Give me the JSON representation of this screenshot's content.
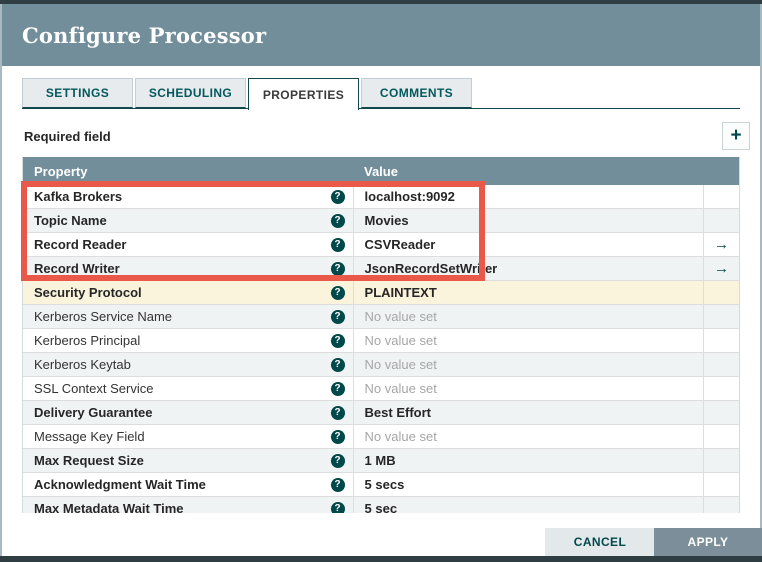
{
  "dialog": {
    "title": "Configure Processor"
  },
  "tabs": [
    {
      "label": "SETTINGS",
      "active": false
    },
    {
      "label": "SCHEDULING",
      "active": false
    },
    {
      "label": "PROPERTIES",
      "active": true
    },
    {
      "label": "COMMENTS",
      "active": false
    }
  ],
  "properties_panel": {
    "required_field_label": "Required field",
    "add_button_glyph": "+",
    "table": {
      "columns": {
        "property": "Property",
        "value": "Value"
      },
      "help_icon_glyph": "?",
      "goto_arrow_glyph": "→",
      "rows": [
        {
          "name": "Kafka Brokers",
          "required": true,
          "value": "localhost:9092",
          "value_set": true,
          "has_arrow": false,
          "highlighted": false
        },
        {
          "name": "Topic Name",
          "required": true,
          "value": "Movies",
          "value_set": true,
          "has_arrow": false,
          "highlighted": false
        },
        {
          "name": "Record Reader",
          "required": true,
          "value": "CSVReader",
          "value_set": true,
          "has_arrow": true,
          "highlighted": false
        },
        {
          "name": "Record Writer",
          "required": true,
          "value": "JsonRecordSetWriter",
          "value_set": true,
          "has_arrow": true,
          "highlighted": false
        },
        {
          "name": "Security Protocol",
          "required": true,
          "value": "PLAINTEXT",
          "value_set": true,
          "has_arrow": false,
          "highlighted": true
        },
        {
          "name": "Kerberos Service Name",
          "required": false,
          "value": "No value set",
          "value_set": false,
          "has_arrow": false,
          "highlighted": false
        },
        {
          "name": "Kerberos Principal",
          "required": false,
          "value": "No value set",
          "value_set": false,
          "has_arrow": false,
          "highlighted": false
        },
        {
          "name": "Kerberos Keytab",
          "required": false,
          "value": "No value set",
          "value_set": false,
          "has_arrow": false,
          "highlighted": false
        },
        {
          "name": "SSL Context Service",
          "required": false,
          "value": "No value set",
          "value_set": false,
          "has_arrow": false,
          "highlighted": false
        },
        {
          "name": "Delivery Guarantee",
          "required": true,
          "value": "Best Effort",
          "value_set": true,
          "has_arrow": false,
          "highlighted": false
        },
        {
          "name": "Message Key Field",
          "required": false,
          "value": "No value set",
          "value_set": false,
          "has_arrow": false,
          "highlighted": false
        },
        {
          "name": "Max Request Size",
          "required": true,
          "value": "1 MB",
          "value_set": true,
          "has_arrow": false,
          "highlighted": false
        },
        {
          "name": "Acknowledgment Wait Time",
          "required": true,
          "value": "5 secs",
          "value_set": true,
          "has_arrow": false,
          "highlighted": false
        },
        {
          "name": "Max Metadata Wait Time",
          "required": true,
          "value": "5 sec",
          "value_set": true,
          "has_arrow": false,
          "highlighted": false
        }
      ]
    }
  },
  "footer": {
    "cancel_label": "CANCEL",
    "apply_label": "APPLY"
  },
  "colors": {
    "header_slate": "#728e9b",
    "accent_teal": "#004849",
    "annotation_red": "#e9594a",
    "highlight_yellow": "#fbf4dc"
  }
}
